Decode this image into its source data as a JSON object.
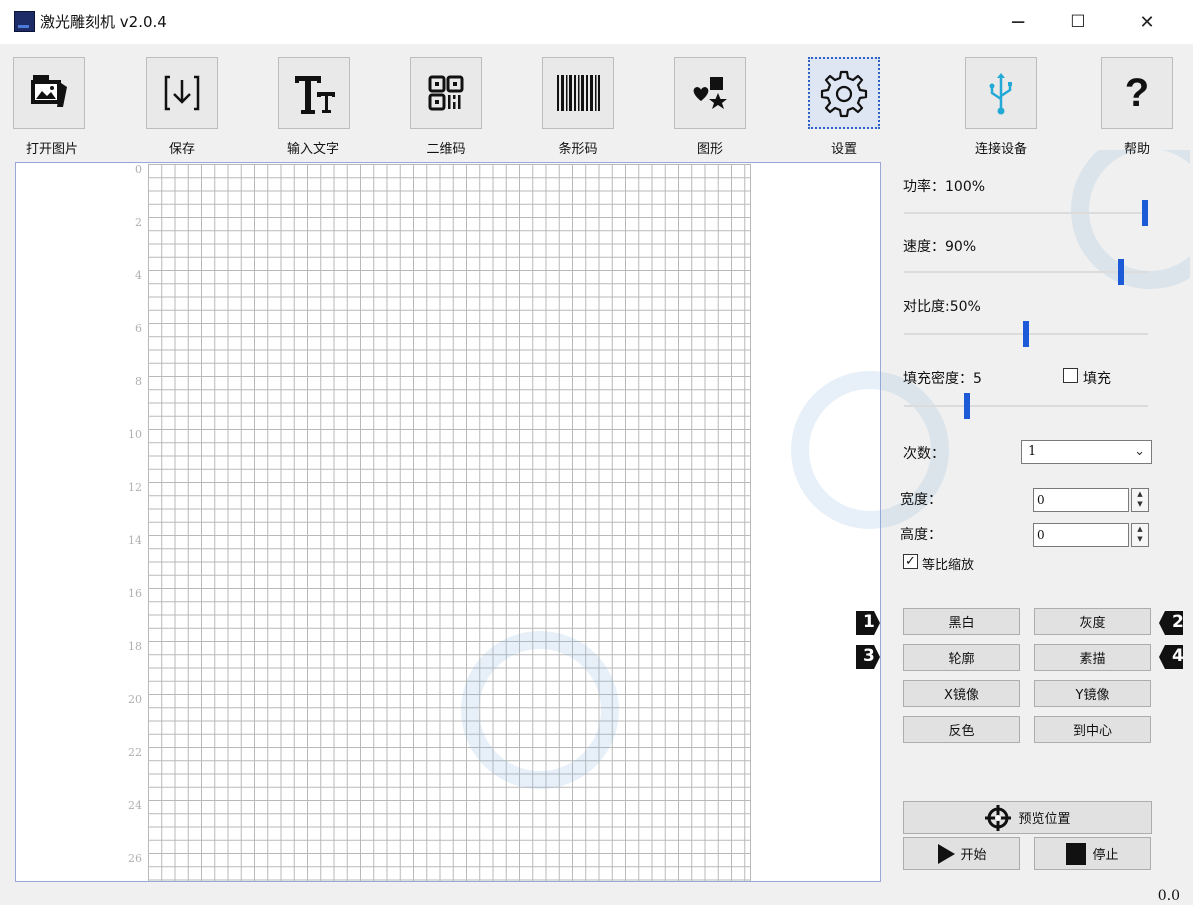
{
  "window": {
    "title": "激光雕刻机 v2.0.4",
    "minimize": "─",
    "maximize": "☐",
    "close": "✕"
  },
  "toolbar": {
    "open_image": {
      "label": "打开图片",
      "icon": "image-folder-icon"
    },
    "save": {
      "label": "保存",
      "icon": "download-icon"
    },
    "input_text": {
      "label": "输入文字",
      "icon": "text-icon"
    },
    "qrcode": {
      "label": "二维码",
      "icon": "qr-code-icon"
    },
    "barcode": {
      "label": "条形码",
      "icon": "barcode-icon"
    },
    "shape": {
      "label": "图形",
      "icon": "shapes-icon"
    },
    "settings": {
      "label": "设置",
      "icon": "gear-icon"
    },
    "connect": {
      "label": "连接设备",
      "icon": "usb-icon"
    },
    "help": {
      "label": "帮助",
      "icon": "help-icon",
      "glyph": "?"
    }
  },
  "canvas": {
    "ticks": [
      "0",
      "2",
      "4",
      "6",
      "8",
      "10",
      "12",
      "14",
      "16",
      "18",
      "20",
      "22",
      "24",
      "26"
    ]
  },
  "params": {
    "power": {
      "label": "功率：100%",
      "value": 100
    },
    "speed": {
      "label": "速度：90%",
      "value": 90
    },
    "contrast": {
      "label": "对比度:50%",
      "value": 50
    },
    "fill_density": {
      "label": "填充密度：5",
      "value": 5
    },
    "fill": {
      "label": "填充",
      "checked": false
    },
    "passes": {
      "label": "次数：",
      "value": "1"
    },
    "width": {
      "label": "宽度：",
      "value": "0"
    },
    "height": {
      "label": "高度：",
      "value": "0"
    },
    "keep_ratio": {
      "label": "等比缩放",
      "checked": true
    }
  },
  "modes": {
    "bw": "黑白",
    "gray": "灰度",
    "outline": "轮廓",
    "sketch": "素描",
    "x_mirror": "X镜像",
    "y_mirror": "Y镜像",
    "invert": "反色",
    "center": "到中心"
  },
  "markers": [
    "1",
    "2",
    "3",
    "4"
  ],
  "actions": {
    "preview": "预览位置",
    "start": "开始",
    "stop": "停止"
  },
  "status": "0.0",
  "colors": {
    "accent": "#1d5ad8",
    "canvas_border": "#9aa8d8",
    "grid": "#b8b8b8"
  }
}
